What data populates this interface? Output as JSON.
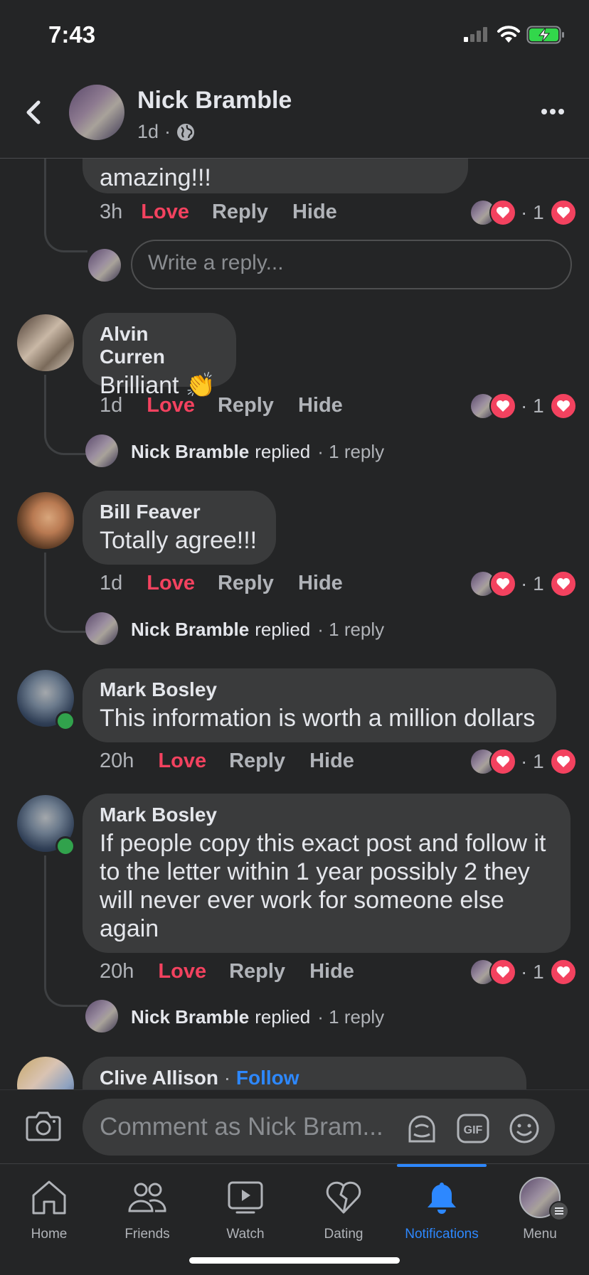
{
  "status_bar": {
    "time": "7:43"
  },
  "header": {
    "name": "Nick Bramble",
    "time": "1d",
    "sep": "·"
  },
  "partial_comment": {
    "text": "amazing!!!",
    "time": "3h",
    "love": "Love",
    "reply": "Reply",
    "hide": "Hide",
    "count": "· 1",
    "write_reply_placeholder": "Write a reply..."
  },
  "comments": [
    {
      "author": "Alvin Curren",
      "text": "Brilliant 👏",
      "time": "1d",
      "love": "Love",
      "reply": "Reply",
      "hide": "Hide",
      "count": "· 1",
      "replied_name": "Nick Bramble",
      "replied_text": "replied",
      "reply_count": "· 1 reply"
    },
    {
      "author": "Bill Feaver",
      "text": "Totally agree!!!",
      "time": "1d",
      "love": "Love",
      "reply": "Reply",
      "hide": "Hide",
      "count": "· 1",
      "replied_name": "Nick Bramble",
      "replied_text": "replied",
      "reply_count": "· 1 reply"
    },
    {
      "author": "Mark Bosley",
      "text": "This information is worth a million dollars",
      "time": "20h",
      "love": "Love",
      "reply": "Reply",
      "hide": "Hide",
      "count": "· 1"
    },
    {
      "author": "Mark Bosley",
      "text": "If people copy this exact post and follow it to the letter within 1 year possibly 2 they will never ever work for someone else again",
      "time": "20h",
      "love": "Love",
      "reply": "Reply",
      "hide": "Hide",
      "count": "· 1",
      "replied_name": "Nick Bramble",
      "replied_text": "replied",
      "reply_count": "· 1 reply"
    },
    {
      "author": "Clive Allison",
      "follow_sep": " · ",
      "follow": "Follow"
    }
  ],
  "composer": {
    "placeholder": "Comment as Nick Bram..."
  },
  "tabs": [
    {
      "label": "Home",
      "icon": "home-icon"
    },
    {
      "label": "Friends",
      "icon": "friends-icon"
    },
    {
      "label": "Watch",
      "icon": "watch-icon"
    },
    {
      "label": "Dating",
      "icon": "dating-icon"
    },
    {
      "label": "Notifications",
      "icon": "bell-icon",
      "active": true
    },
    {
      "label": "Menu",
      "icon": "menu-avatar"
    }
  ],
  "colors": {
    "background": "#242526",
    "bubble": "#3a3b3c",
    "love": "#f3425f",
    "accent": "#2d88ff",
    "online": "#31a24c"
  }
}
